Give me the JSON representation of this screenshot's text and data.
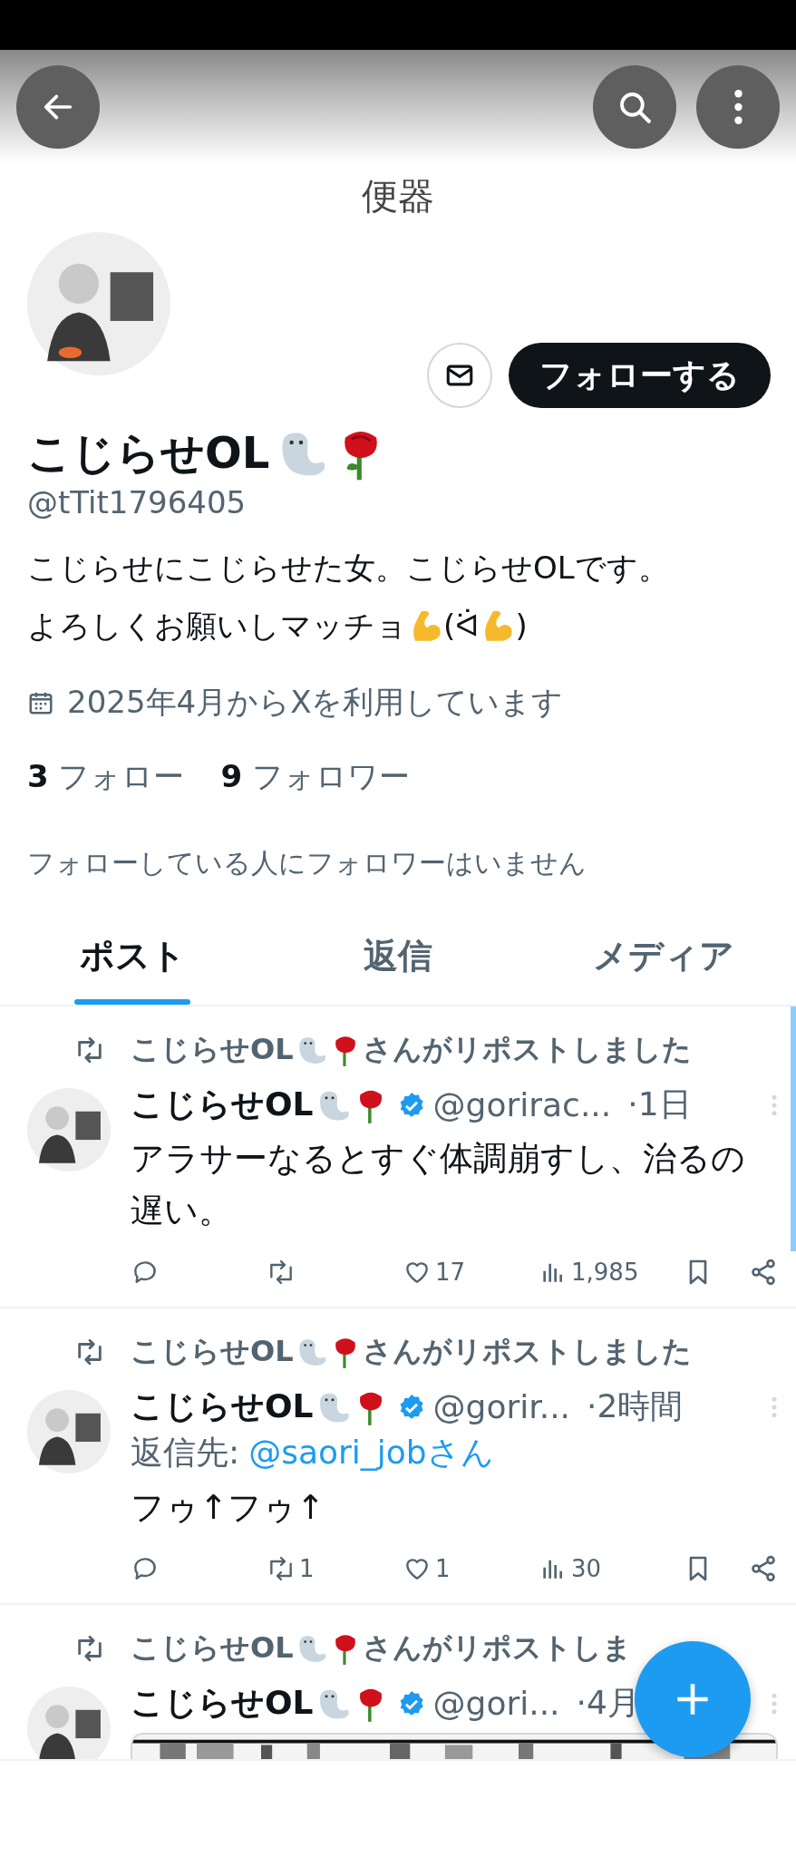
{
  "header": {
    "title": "便器"
  },
  "profile": {
    "name": "こじらせOL",
    "handle": "@tTit1796405",
    "follow_button": "フォローする",
    "bio": [
      [
        {
          "kind": "text",
          "text": "こじらせにこじらせた女。こじらせOLです。"
        }
      ],
      [
        {
          "kind": "text",
          "text": "よろしくお願いしマッチョ"
        },
        {
          "kind": "emoji"
        },
        {
          "kind": "text",
          "text": "(ᐛ"
        },
        {
          "kind": "emoji"
        },
        {
          "kind": "text",
          "text": ")"
        }
      ]
    ],
    "joined": "2025年4月からXを利用しています",
    "stats": [
      {
        "count": "3",
        "label": "フォロー"
      },
      {
        "count": "9",
        "label": "フォロワー"
      }
    ],
    "followers_note": "フォローしている人にフォロワーはいません"
  },
  "tabs": [
    {
      "label": "ポスト",
      "selected": true
    },
    {
      "label": "返信",
      "selected": false
    },
    {
      "label": "メディア",
      "selected": false
    }
  ],
  "posts": [
    {
      "reposted_by": "こじらせOL",
      "repost_suffix": "さんがリポストしました",
      "author": "こじらせOL",
      "verified": true,
      "handle": "@gorirac...",
      "time": "·1日",
      "text": "アラサーなるとすぐ体調崩すし、治るの遅い。",
      "actions": {
        "likes": "17",
        "views": "1,985"
      }
    },
    {
      "reposted_by": "こじらせOL",
      "repost_suffix": "さんがリポストしました",
      "author": "こじらせOL",
      "verified": true,
      "handle": "@gorir...",
      "time": "·2時間",
      "reply_prefix": "返信先:",
      "reply_to": "@saori_jobさん",
      "text": "フゥ↑フゥ↑",
      "actions": {
        "reposts": "1",
        "likes": "1",
        "views": "30"
      }
    },
    {
      "reposted_by": "こじらせOL",
      "repost_suffix": "さんがリポストしま",
      "author": "こじらせOL",
      "verified": true,
      "handle": "@gori...",
      "time": "·4月"
    }
  ]
}
